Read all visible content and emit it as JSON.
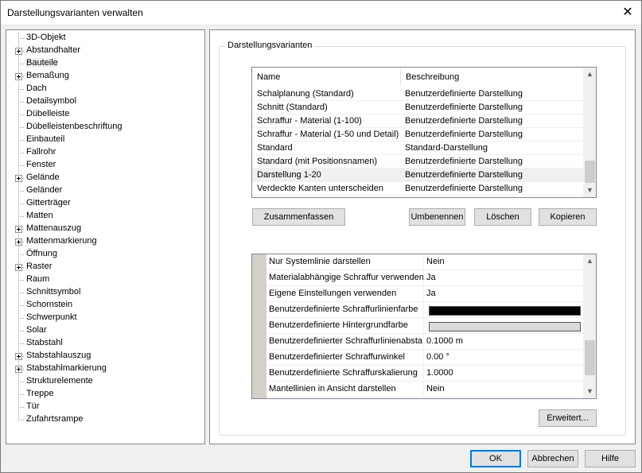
{
  "window": {
    "title": "Darstellungsvarianten verwalten",
    "close_glyph": "✕"
  },
  "tree": {
    "items": [
      {
        "label": "3D-Objekt",
        "expandable": false
      },
      {
        "label": "Abstandhalter",
        "expandable": true
      },
      {
        "label": "Bauteile",
        "expandable": false,
        "selected": true
      },
      {
        "label": "Bemaßung",
        "expandable": true
      },
      {
        "label": "Dach",
        "expandable": false
      },
      {
        "label": "Detailsymbol",
        "expandable": false
      },
      {
        "label": "Dübelleiste",
        "expandable": false
      },
      {
        "label": "Dübelleistenbeschriftung",
        "expandable": false
      },
      {
        "label": "Einbauteil",
        "expandable": false
      },
      {
        "label": "Fallrohr",
        "expandable": false
      },
      {
        "label": "Fenster",
        "expandable": false
      },
      {
        "label": "Gelände",
        "expandable": true
      },
      {
        "label": "Geländer",
        "expandable": false
      },
      {
        "label": "Gitterträger",
        "expandable": false
      },
      {
        "label": "Matten",
        "expandable": false
      },
      {
        "label": "Mattenauszug",
        "expandable": true
      },
      {
        "label": "Mattenmarkierung",
        "expandable": true
      },
      {
        "label": "Öffnung",
        "expandable": false
      },
      {
        "label": "Raster",
        "expandable": true
      },
      {
        "label": "Raum",
        "expandable": false
      },
      {
        "label": "Schnittsymbol",
        "expandable": false
      },
      {
        "label": "Schornstein",
        "expandable": false
      },
      {
        "label": "Schwerpunkt",
        "expandable": false
      },
      {
        "label": "Solar",
        "expandable": false
      },
      {
        "label": "Stabstahl",
        "expandable": false
      },
      {
        "label": "Stabstahlauszug",
        "expandable": true
      },
      {
        "label": "Stabstahlmarkierung",
        "expandable": true
      },
      {
        "label": "Strukturelemente",
        "expandable": false
      },
      {
        "label": "Treppe",
        "expandable": false
      },
      {
        "label": "Tür",
        "expandable": false
      },
      {
        "label": "Zufahrtsrampe",
        "expandable": false
      }
    ]
  },
  "group": {
    "title": "Darstellungsvarianten"
  },
  "variants": {
    "columns": [
      "Name",
      "Beschreibung"
    ],
    "rows": [
      {
        "name": "Schalplanung (Standard)",
        "description": "Benutzerdefinierte Darstellung"
      },
      {
        "name": "Schnitt (Standard)",
        "description": "Benutzerdefinierte Darstellung"
      },
      {
        "name": "Schraffur - Material (1-100)",
        "description": "Benutzerdefinierte Darstellung"
      },
      {
        "name": "Schraffur - Material (1-50 und Detail)",
        "description": "Benutzerdefinierte Darstellung"
      },
      {
        "name": "Standard",
        "description": "Standard-Darstellung"
      },
      {
        "name": "Standard (mit Positionsnamen)",
        "description": "Benutzerdefinierte Darstellung"
      },
      {
        "name": "Darstellung 1-20",
        "description": "Benutzerdefinierte Darstellung",
        "selected": true
      },
      {
        "name": "Verdeckte Kanten unterscheiden",
        "description": "Benutzerdefinierte Darstellung"
      }
    ]
  },
  "buttons": {
    "merge": "Zusammenfassen",
    "rename": "Umbenennen",
    "delete": "Löschen",
    "copy": "Kopieren",
    "advanced": "Erweitert...",
    "ok": "OK",
    "cancel": "Abbrechen",
    "help": "Hilfe"
  },
  "properties": {
    "rows": [
      {
        "name": "Nur Systemlinie darstellen",
        "value": "Nein"
      },
      {
        "name": "Materialabhängige Schraffur verwenden",
        "value": "Ja"
      },
      {
        "name": "Eigene Einstellungen verwenden",
        "value": "Ja"
      },
      {
        "name": "Benutzerdefinierte Schraffurlinienfarbe",
        "value": "",
        "color": "#000000"
      },
      {
        "name": "Benutzerdefinierte Hintergrundfarbe",
        "value": "",
        "color": "#d9d9d9"
      },
      {
        "name": "Benutzerdefinierter Schraffurlinienabsta",
        "value": "0.1000 m"
      },
      {
        "name": "Benutzerdefinierter Schraffurwinkel",
        "value": "0.00 °"
      },
      {
        "name": "Benutzerdefinierte Schraffurskalierung",
        "value": "1.0000"
      },
      {
        "name": "Mantellinien in Ansicht darstellen",
        "value": "Nein"
      }
    ]
  },
  "icons": {
    "scroll_up": "▲",
    "scroll_down": "▼"
  }
}
